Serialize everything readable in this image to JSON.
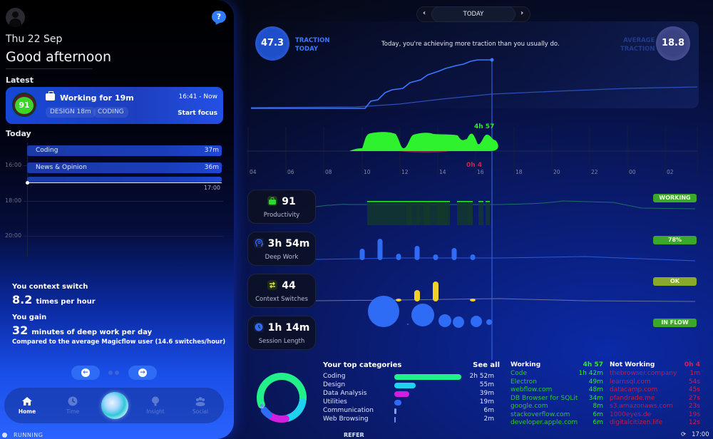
{
  "sidebar": {
    "date": "Thu 22 Sep",
    "greeting": "Good afternoon",
    "latest_label": "Latest",
    "latest": {
      "score": "91",
      "title": "Working for 19m",
      "chips": [
        "DESIGN 18m",
        "CODING"
      ],
      "time_range": "16:41 - Now",
      "action": "Start focus"
    },
    "today_label": "Today",
    "timeline": {
      "hours": [
        "16:00",
        "18:00",
        "20:00"
      ],
      "blocks": [
        {
          "name": "Coding",
          "duration": "37m"
        },
        {
          "name": "News & Opinion",
          "duration": "36m"
        }
      ],
      "now_label": "17:00"
    },
    "insight": {
      "switch_heading": "You context switch",
      "switch_value": "8.2",
      "switch_unit": "times per hour",
      "gain_heading": "You gain",
      "gain_value": "32",
      "gain_unit": "minutes of deep work per day",
      "comparison": "Compared to the average Magicflow user (14.6 switches/hour)"
    },
    "nav": [
      {
        "label": "Home",
        "icon": "home-icon",
        "active": true
      },
      {
        "label": "Time",
        "icon": "clock-icon",
        "active": false
      },
      {
        "label": "Insight",
        "icon": "lightbulb-icon",
        "active": false
      },
      {
        "label": "Social",
        "icon": "people-icon",
        "active": false
      }
    ],
    "status": "RUNNING"
  },
  "header": {
    "date_nav_label": "TODAY",
    "prev": "‹",
    "next": "›"
  },
  "traction": {
    "today_value": "47.3",
    "today_label_1": "TRACTION",
    "today_label_2": "TODAY",
    "average_value": "18.8",
    "average_label_1": "AVERAGE",
    "average_label_2": "TRACTION",
    "message": "Today, you're achieving more traction than you usually do."
  },
  "chart_data": [
    {
      "type": "line",
      "title": "Traction",
      "x": [
        "04",
        "06",
        "08",
        "10",
        "12",
        "14",
        "16"
      ],
      "series": [
        {
          "name": "Today",
          "color": "#3a78ff",
          "values": [
            0,
            0,
            0,
            8,
            18,
            30,
            47.3
          ]
        },
        {
          "name": "Average",
          "color": "#2a4fb8",
          "values": [
            0,
            0,
            0,
            3,
            8,
            13,
            18.8
          ]
        }
      ],
      "current_hour": 16.7
    },
    {
      "type": "area",
      "title": "Working vs Not Working",
      "x_ticks": [
        "04",
        "06",
        "08",
        "10",
        "12",
        "14",
        "16",
        "18",
        "20",
        "22",
        "00",
        "02"
      ],
      "working_total": "4h 57",
      "not_working_total": "0h 4",
      "working_color": "#2ef22e",
      "not_working_color": "#e0204a"
    }
  ],
  "metrics": [
    {
      "value": "91",
      "label": "Productivity",
      "icon": "briefcase-icon",
      "icon_color": "#2ed82e",
      "status": "WORKING",
      "status_color": "#3aa82a"
    },
    {
      "value": "3h 54m",
      "label": "Deep Work",
      "icon": "head-icon",
      "icon_color": "#2f6cf6",
      "status": "78%",
      "status_color": "#3aa82a"
    },
    {
      "value": "44",
      "label": "Context Switches",
      "icon": "switch-arrows-icon",
      "icon_color": "#d8e030",
      "status": "OK",
      "status_color": "#8aa82a"
    },
    {
      "value": "1h 14m",
      "label": "Session Length",
      "icon": "clock-icon",
      "icon_color": "#2f6cf6",
      "status": "IN FLOW",
      "status_color": "#3aa82a"
    }
  ],
  "top_categories": {
    "title": "Your top categories",
    "see_all": "See all",
    "items": [
      {
        "name": "Coding",
        "duration": "2h 52m",
        "minutes": 172,
        "color": "#22f08a"
      },
      {
        "name": "Design",
        "duration": "55m",
        "minutes": 55,
        "color": "#1ed2f0"
      },
      {
        "name": "Data Analysis",
        "duration": "39m",
        "minutes": 39,
        "color": "#d21ee0"
      },
      {
        "name": "Utilities",
        "duration": "19m",
        "minutes": 19,
        "color": "#2f6cf6"
      },
      {
        "name": "Communication",
        "duration": "6m",
        "minutes": 6,
        "color": "#8aa0f0"
      },
      {
        "name": "Web Browsing",
        "duration": "2m",
        "minutes": 2,
        "color": "#6a8cf6"
      }
    ]
  },
  "working": {
    "title": "Working",
    "total": "4h 57",
    "items": [
      {
        "name": "Code",
        "time": "1h 42m"
      },
      {
        "name": "Electron",
        "time": "49m"
      },
      {
        "name": "webflow.com",
        "time": "48m"
      },
      {
        "name": "DB Browser for SQLit",
        "time": "34m"
      },
      {
        "name": "google.com",
        "time": "8m"
      },
      {
        "name": "stackoverflow.com",
        "time": "6m"
      },
      {
        "name": "developer.apple.com",
        "time": "6m"
      }
    ]
  },
  "not_working": {
    "title": "Not Working",
    "total": "0h 4",
    "items": [
      {
        "name": "thebrowser.company",
        "time": "1m"
      },
      {
        "name": "learnsql.com",
        "time": "54s"
      },
      {
        "name": "datacamp.com",
        "time": "45s"
      },
      {
        "name": "pfandrade.me",
        "time": "27s"
      },
      {
        "name": "s3.amazonaws.com",
        "time": "23s"
      },
      {
        "name": "1000eyes.de",
        "time": "19s"
      },
      {
        "name": "digitalcitizen.life",
        "time": "12s"
      }
    ]
  },
  "footer": {
    "refer": "REFER",
    "clock": "17:00",
    "sync_icon": "sync-icon"
  }
}
